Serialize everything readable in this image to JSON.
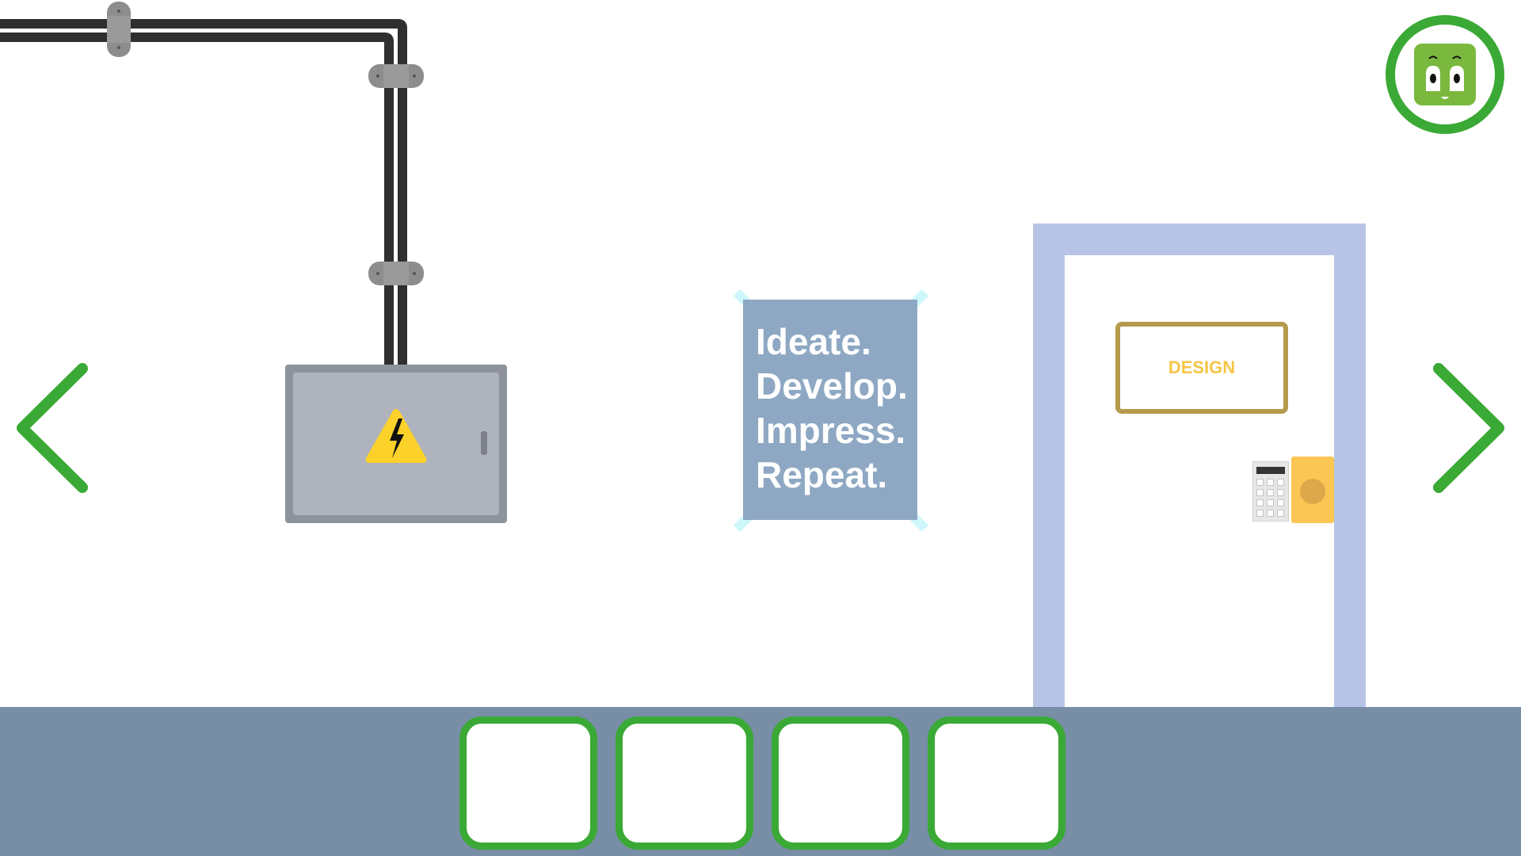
{
  "scene": {
    "poster": {
      "lines": [
        "Ideate.",
        "Develop.",
        "Impress.",
        "Repeat."
      ]
    },
    "door": {
      "sign": "DESIGN"
    },
    "electrical_box": {
      "icon": "high-voltage-icon"
    }
  },
  "navigation": {
    "left": "chevron-left-icon",
    "right": "chevron-right-icon",
    "menu": "character-avatar-icon"
  },
  "inventory": {
    "slots": [
      {},
      {},
      {},
      {}
    ]
  },
  "colors": {
    "accent_green": "#3aa935",
    "inventory_bar": "#778ea6",
    "poster": "#8ea8c3",
    "door_frame": "#b7c4e5",
    "sign_text": "#f5c546",
    "lock_plate": "#fbc653",
    "warning_yellow": "#fcd12a",
    "pipe": "#2f2f2f",
    "electrical_box": "#aeb3be"
  }
}
